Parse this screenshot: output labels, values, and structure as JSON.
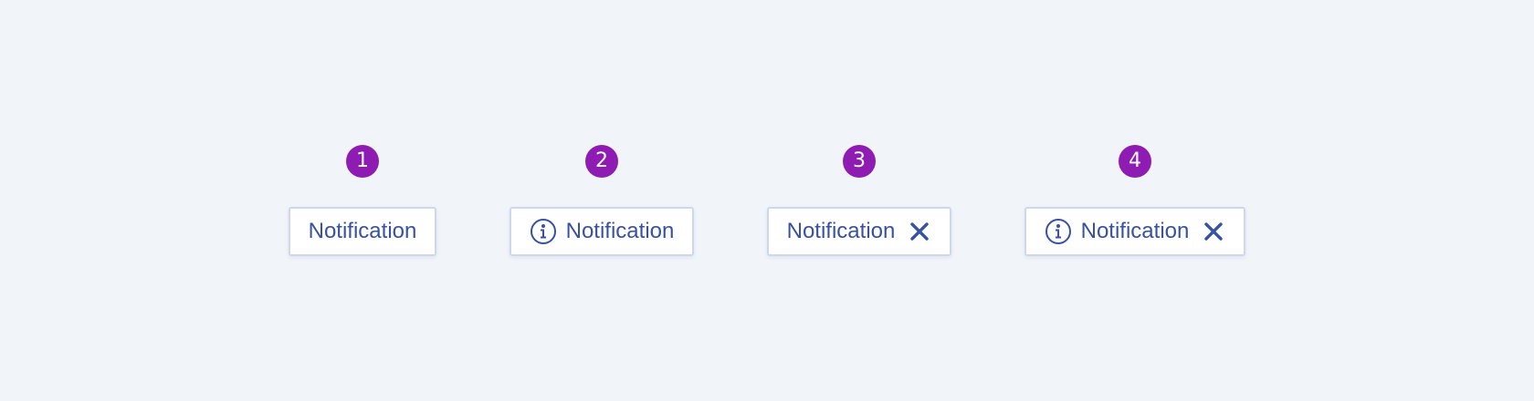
{
  "notifications": [
    {
      "badge": "1",
      "label": "Notification",
      "has_info_icon": false,
      "has_close_icon": false
    },
    {
      "badge": "2",
      "label": "Notification",
      "has_info_icon": true,
      "has_close_icon": false
    },
    {
      "badge": "3",
      "label": "Notification",
      "has_info_icon": false,
      "has_close_icon": true
    },
    {
      "badge": "4",
      "label": "Notification",
      "has_info_icon": true,
      "has_close_icon": true
    }
  ],
  "icons": {
    "info": "info-icon",
    "close": "close-icon"
  },
  "colors": {
    "background": "#f1f4f9",
    "badge": "#8e1bb2",
    "badge_text": "#ffffff",
    "text": "#3851a3",
    "pill_border": "#cfd7ec",
    "pill_background": "#ffffff"
  }
}
